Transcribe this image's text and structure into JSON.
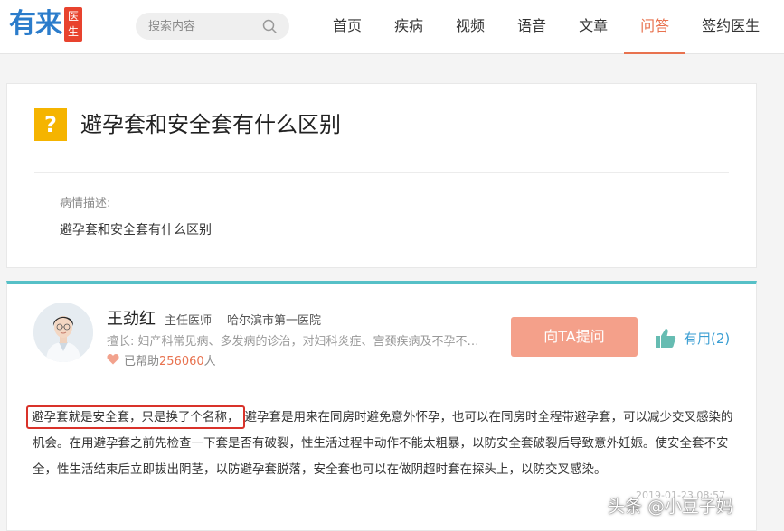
{
  "logo": {
    "main": "有来",
    "badge": "医生"
  },
  "search": {
    "placeholder": "搜索内容"
  },
  "nav": {
    "items": [
      {
        "label": "首页"
      },
      {
        "label": "疾病"
      },
      {
        "label": "视频"
      },
      {
        "label": "语音"
      },
      {
        "label": "文章"
      },
      {
        "label": "问答",
        "active": true
      },
      {
        "label": "签约医生"
      }
    ]
  },
  "question": {
    "icon": "?",
    "title": "避孕套和安全套有什么区别",
    "desc_label": "病情描述:",
    "desc_text": "避孕套和安全套有什么区别"
  },
  "answer": {
    "doctor_name": "王劲红",
    "doctor_title": "主任医师",
    "hospital": "哈尔滨市第一医院",
    "specialty": "擅长: 妇产科常见病、多发病的诊治，对妇科炎症、宫颈疾病及不孕不育等有丰富经验",
    "helped_prefix": "已帮助",
    "helped_count": "256060",
    "helped_suffix": "人",
    "ask_button": "向TA提问",
    "useful_label": "有用(2)",
    "text_highlight": "避孕套就是安全套，只是换了个名称，",
    "text_body": "避孕套是用来在同房时避免意外怀孕，也可以在同房时全程带避孕套，可以减少交叉感染的机会。在用避孕套之前先检查一下套是否有破裂，性生活过程中动作不能太粗暴，以防安全套破裂后导致意外妊娠。使安全套不安全，性生活结束后立即拔出阴茎，以防避孕套脱落，安全套也可以在做阴超时套在探头上，以防交叉感染。",
    "timestamp": "2019-01-23 08:57"
  },
  "watermark": "头条 @小豆子妈",
  "colors": {
    "accent": "#e8724f",
    "brand_blue": "#2b7ccb",
    "teal": "#56c0c7",
    "highlight_box": "#d9322a"
  }
}
